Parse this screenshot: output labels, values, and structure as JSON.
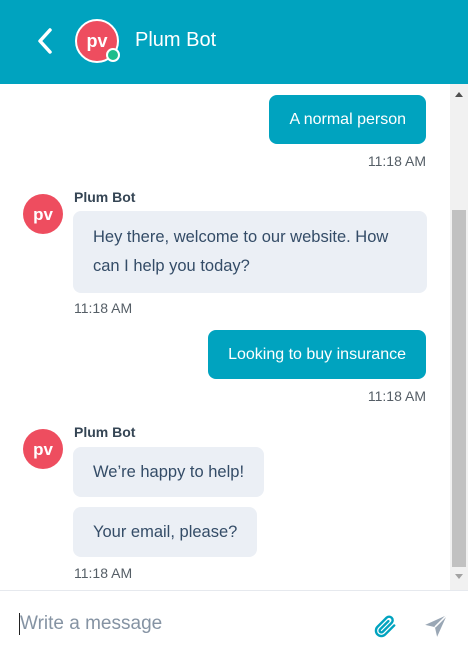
{
  "header": {
    "bot_name": "Plum Bot",
    "status": "online",
    "brand_color": "#00a3bf",
    "avatar_color": "#ee4d5f",
    "avatar_logo": "pv"
  },
  "messages": [
    {
      "from": "user",
      "text": "A normal person",
      "time": "11:18 AM"
    },
    {
      "from": "bot",
      "sender": "Plum Bot",
      "text": "Hey there, welcome to our website. How can I help you today?",
      "time": "11:18 AM"
    },
    {
      "from": "user",
      "text": "Looking to buy insurance",
      "time": "11:18 AM"
    },
    {
      "from": "bot",
      "sender": "Plum Bot",
      "texts": [
        "We’re happy to help!",
        "Your email, please?"
      ],
      "time": "11:18 AM"
    }
  ],
  "composer": {
    "placeholder": "Write a message",
    "value": "",
    "attach_icon": "paperclip-icon",
    "send_icon": "send-icon"
  }
}
